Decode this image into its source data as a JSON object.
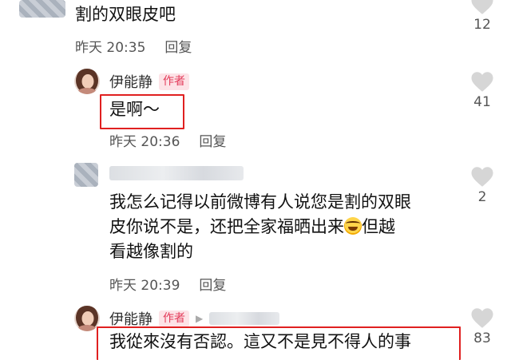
{
  "comments": [
    {
      "text": "割的双眼皮吧",
      "time": "昨天 20:35",
      "reply_label": "回复",
      "likes": "12"
    },
    {
      "user": "伊能静",
      "badge": "作者",
      "text": "是啊～",
      "time": "昨天 20:36",
      "reply_label": "回复",
      "likes": "41"
    },
    {
      "line1": "我怎么记得以前微博有人说您是割的双眼",
      "line2a": "皮你说不是，还把全家福晒出来",
      "emoji": "rolling-on-floor-laughing-emoji",
      "line2b": "但越",
      "line3": "看越像割的",
      "time": "昨天 20:39",
      "reply_label": "回复",
      "likes": "2"
    },
    {
      "user": "伊能静",
      "badge": "作者",
      "arrow": "▶",
      "text": "我從來沒有否認。這又不是見不得人的事",
      "likes": "83"
    }
  ],
  "colors": {
    "highlight": "#e02020",
    "badge_bg": "#fde3e7",
    "badge_text": "#e33b5a"
  }
}
